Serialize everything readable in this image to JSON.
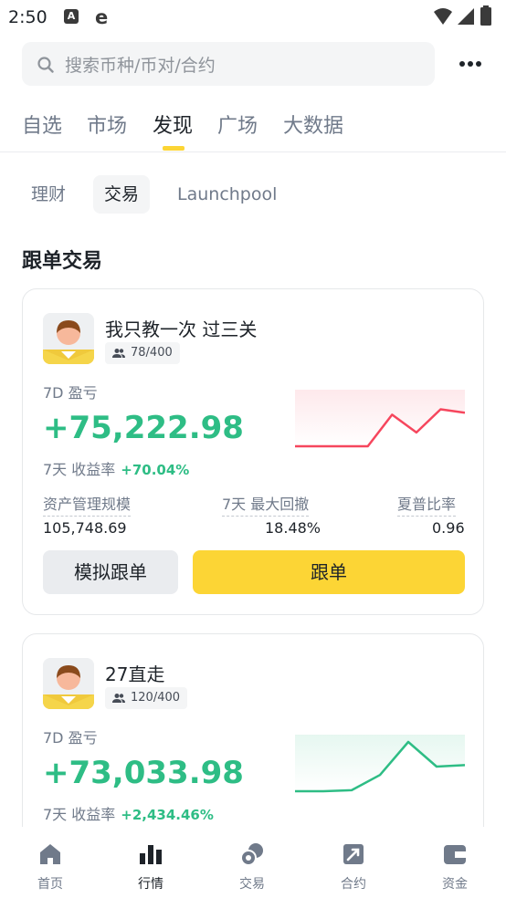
{
  "status_bar": {
    "time": "2:50"
  },
  "search": {
    "placeholder": "搜索币种/币对/合约"
  },
  "tabs": [
    {
      "label": "自选"
    },
    {
      "label": "市场"
    },
    {
      "label": "发现"
    },
    {
      "label": "广场"
    },
    {
      "label": "大数据"
    }
  ],
  "subtabs": [
    {
      "label": "理财"
    },
    {
      "label": "交易"
    },
    {
      "label": "Launchpool"
    }
  ],
  "section_title": "跟单交易",
  "cards": [
    {
      "name": "我只教一次 过三关",
      "followers": "78/400",
      "pnl_label": "7D 盈亏",
      "pnl": "+75,222.98",
      "roi_label": "7天 收益率",
      "roi": "+70.04%",
      "stats": [
        {
          "label": "资产管理规模",
          "value": "105,748.69"
        },
        {
          "label": "7天 最大回撤",
          "value": "18.48%"
        },
        {
          "label": "夏普比率",
          "value": "0.96"
        }
      ],
      "sim_button": "模拟跟单",
      "follow_button": "跟单",
      "sparkline_color": "#f6465d",
      "sparkline": [
        0.0,
        0.0,
        0.0,
        0.0,
        0.64,
        0.28,
        0.75,
        0.68
      ]
    },
    {
      "name": "27直走",
      "followers": "120/400",
      "pnl_label": "7D 盈亏",
      "pnl": "+73,033.98",
      "roi_label": "7天 收益率",
      "roi": "+2,434.46%",
      "sparkline_color": "#2ebd85",
      "sparkline": [
        0.0,
        0.0,
        0.02,
        0.33,
        1.0,
        0.5,
        0.53
      ]
    }
  ],
  "bottom_nav": [
    {
      "label": "首页",
      "icon": "home-icon"
    },
    {
      "label": "行情",
      "icon": "bar-chart-icon"
    },
    {
      "label": "交易",
      "icon": "coins-icon"
    },
    {
      "label": "合约",
      "icon": "futures-icon"
    },
    {
      "label": "资金",
      "icon": "wallet-icon"
    }
  ],
  "colors": {
    "brand_yellow": "#fcd535",
    "up_green": "#2ebd85",
    "down_red": "#f6465d"
  }
}
